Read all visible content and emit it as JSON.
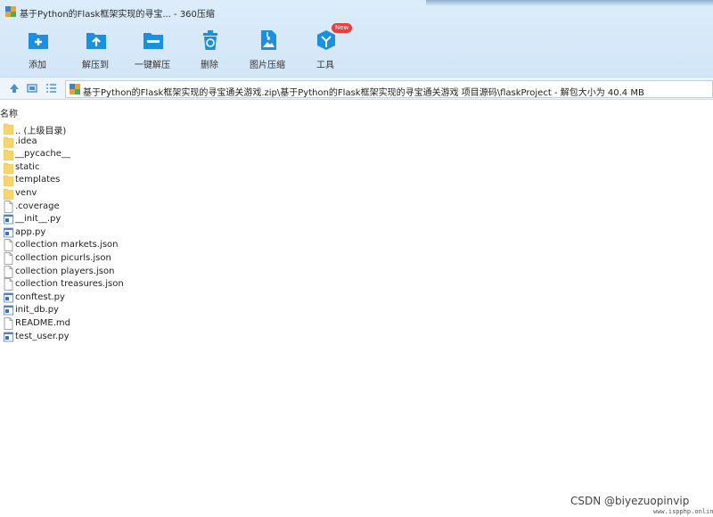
{
  "window": {
    "title": "基于Python的Flask框架实现的寻宝... - 360压缩"
  },
  "toolbar": {
    "items": [
      {
        "label": "添加",
        "icon": "add-folder-icon"
      },
      {
        "label": "解压到",
        "icon": "extract-to-icon"
      },
      {
        "label": "一键解压",
        "icon": "one-click-extract-icon"
      },
      {
        "label": "删除",
        "icon": "recycle-bin-icon"
      },
      {
        "label": "图片压缩",
        "icon": "image-compress-icon"
      },
      {
        "label": "工具",
        "icon": "tools-cube-icon",
        "badge": "New"
      }
    ]
  },
  "address": {
    "path": "基于Python的Flask框架实现的寻宝通关游戏.zip\\基于Python的Flask框架实现的寻宝通关游戏 项目源码\\flaskProject - 解包大小为 40.4 MB"
  },
  "list": {
    "column_header": "名称",
    "items": [
      {
        "name": ".. (上级目录)",
        "type": "folder"
      },
      {
        "name": ".idea",
        "type": "folder"
      },
      {
        "name": "__pycache__",
        "type": "folder"
      },
      {
        "name": "static",
        "type": "folder"
      },
      {
        "name": "templates",
        "type": "folder"
      },
      {
        "name": "venv",
        "type": "folder"
      },
      {
        "name": ".coverage",
        "type": "file"
      },
      {
        "name": "__init__.py",
        "type": "python"
      },
      {
        "name": "app.py",
        "type": "python"
      },
      {
        "name": "collection markets.json",
        "type": "file"
      },
      {
        "name": "collection picurls.json",
        "type": "file"
      },
      {
        "name": "collection players.json",
        "type": "file"
      },
      {
        "name": "collection treasures.json",
        "type": "file"
      },
      {
        "name": "conftest.py",
        "type": "python"
      },
      {
        "name": "init_db.py",
        "type": "python"
      },
      {
        "name": "README.md",
        "type": "file"
      },
      {
        "name": "test_user.py",
        "type": "python"
      }
    ]
  },
  "watermark": {
    "text": "CSDN @biyezuopinvip",
    "site": "www.ispphp.online"
  },
  "colors": {
    "toolbar_bg": "#d6e8f9",
    "icon_blue": "#1b8fe0",
    "folder_yellow": "#f7d66b",
    "badge_red": "#ee3b3b"
  }
}
